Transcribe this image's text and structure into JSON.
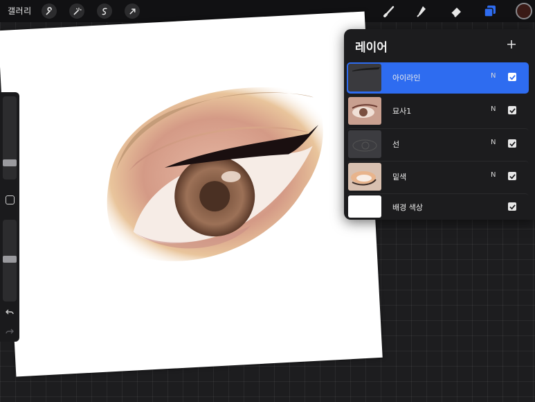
{
  "topbar": {
    "gallery_label": "갤러리",
    "left_tools": [
      "wrench-icon",
      "magic-wand-icon",
      "selection-icon",
      "transform-arrow-icon"
    ],
    "right_tools": [
      "brush-icon",
      "smudge-icon",
      "eraser-icon",
      "layers-icon"
    ],
    "current_color": "#3a1a16",
    "accent_color": "#2e6cf0"
  },
  "sidebar": {
    "icons": [
      "brush-size-slider",
      "modify-square-icon",
      "opacity-slider",
      "undo-icon",
      "redo-icon"
    ],
    "size_level": 0.72,
    "opacity_level": 0.45
  },
  "layers_panel": {
    "title": "레이어",
    "add_icon": "plus-icon",
    "layers": [
      {
        "name": "아이라인",
        "mode": "N",
        "visible": true,
        "active": true
      },
      {
        "name": "묘사1",
        "mode": "N",
        "visible": true,
        "active": false
      },
      {
        "name": "선",
        "mode": "N",
        "visible": true,
        "active": false
      },
      {
        "name": "밑색",
        "mode": "N",
        "visible": true,
        "active": false
      },
      {
        "name": "배경 색상",
        "mode": "",
        "visible": true,
        "active": false
      }
    ]
  }
}
